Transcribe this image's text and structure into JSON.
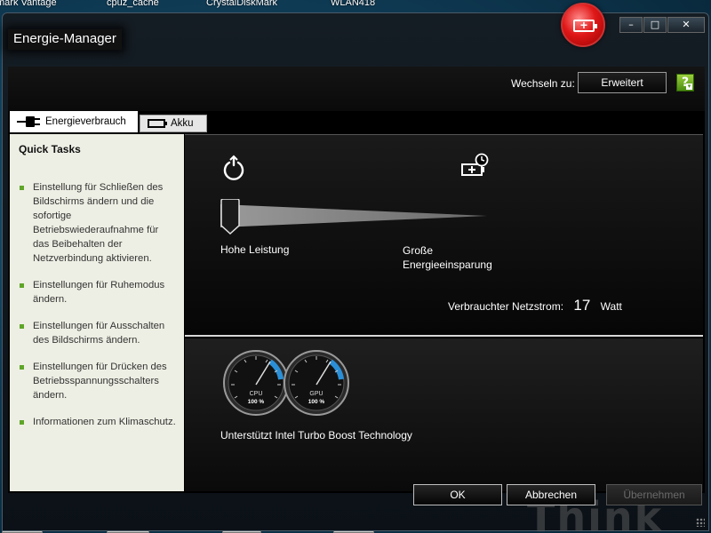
{
  "desktop": {
    "icons": [
      "mark Vantage",
      "cpuz_cache",
      "CrystalDiskMark",
      "WLAN418"
    ]
  },
  "window": {
    "title": "Energie-Manager",
    "minimize": "–",
    "maximize": "□",
    "close": "✕"
  },
  "header": {
    "switch_label": "Wechseln zu:",
    "switch_button": "Erweitert",
    "help": "?"
  },
  "tabs": [
    {
      "label": "Energieverbrauch",
      "active": true,
      "icon": "plug-icon"
    },
    {
      "label": "Akku",
      "active": false,
      "icon": "battery-icon"
    }
  ],
  "sidebar": {
    "title": "Quick Tasks",
    "tasks": [
      "Einstellung für Schließen des Bildschirms ändern und die sofortige Betriebswiederaufnahme für das Beibehalten der Netzverbindung aktivieren.",
      "Einstellungen für Ruhemodus ändern.",
      "Einstellungen für Ausschalten des Bildschirms ändern.",
      "Einstellungen für Drücken des Betriebsspannungsschalters ändern.",
      "Informationen zum Klimaschutz."
    ]
  },
  "power_plan": {
    "label_high": "Hohe Leistung",
    "label_save_line1": "Große",
    "label_save_line2": "Energieeinsparung",
    "slider_value": 0,
    "consumption_label": "Verbrauchter Netzstrom:",
    "consumption_value": "17",
    "consumption_unit": "Watt"
  },
  "gauges": {
    "cpu": {
      "label": "CPU",
      "value": "100 %"
    },
    "gpu": {
      "label": "GPU",
      "value": "100 %"
    },
    "turbo_text": "Unterstützt Intel Turbo Boost Technology"
  },
  "footer": {
    "ok": "OK",
    "cancel": "Abbrechen",
    "apply": "Übernehmen",
    "brand_watermark": "Think"
  },
  "colors": {
    "accent_green": "#5ea528",
    "badge_red": "#e01818",
    "gauge_blue": "#2a8fd6"
  }
}
